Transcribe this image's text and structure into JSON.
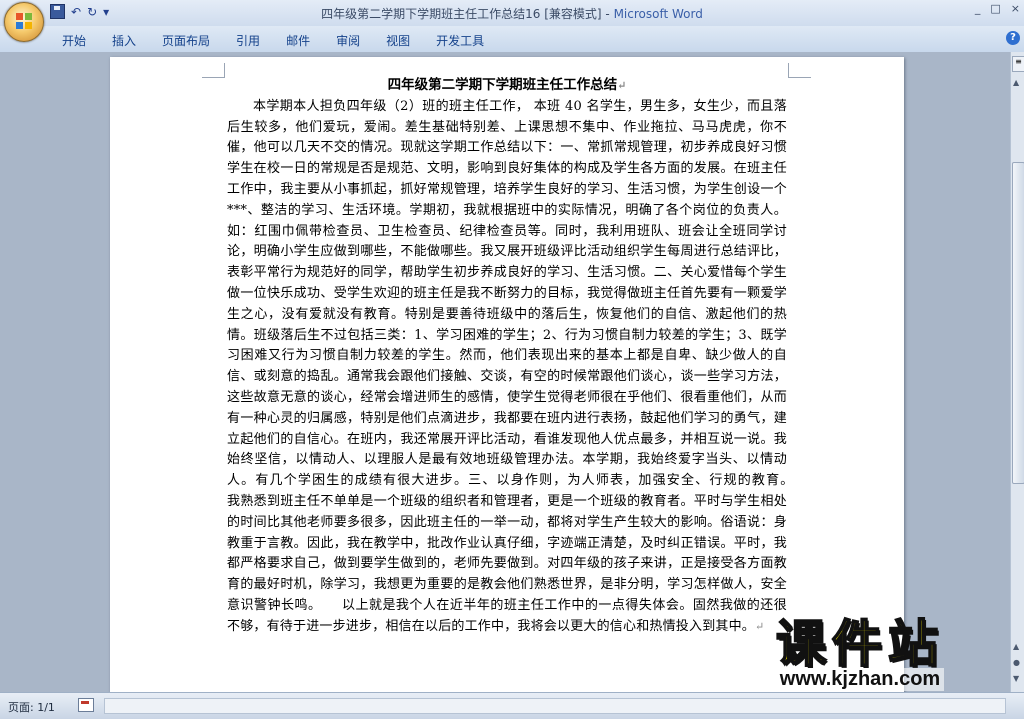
{
  "window": {
    "title": "四年级第二学期下学期班主任工作总结16 [兼容模式] - ",
    "app_name": "Microsoft Word",
    "controls": [
      "_",
      "□",
      "×"
    ]
  },
  "qat": {
    "undo_glyph": "↶",
    "redo_glyph": "↻",
    "dropdown_glyph": "▾"
  },
  "ribbon": {
    "tabs": [
      "开始",
      "插入",
      "页面布局",
      "引用",
      "邮件",
      "审阅",
      "视图",
      "开发工具"
    ],
    "help_label": "?"
  },
  "document": {
    "title": "四年级第二学期下学期班主任工作总结",
    "body": "本学期本人担负四年级（2）班的班主任工作， 本班 40 名学生，男生多，女生少，而且落后生较多，他们爱玩，爱闹。差生基础特别差、上课思想不集中、作业拖拉、马马虎虎，你不催，他可以几天不交的情况。现就这学期工作总结以下：一、常抓常规管理，初步养成良好习惯　　学生在校一日的常规是否是规范、文明，影响到良好集体的构成及学生各方面的发展。在班主任工作中，我主要从小事抓起，抓好常规管理，培养学生良好的学习、生活习惯，为学生创设一个***、整洁的学习、生活环境。学期初，我就根据班中的实际情况，明确了各个岗位的负责人。如：红围巾佩带检查员、卫生检查员、纪律检查员等。同时，我利用班队、班会让全班同学讨论，明确小学生应做到哪些，不能做哪些。我又展开班级评比活动组织学生每周进行总结评比，表彰平常行为规范好的同学，帮助学生初步养成良好的学习、生活习惯。二、关心爱惜每个学生　　做一位快乐成功、受学生欢迎的班主任是我不断努力的目标，我觉得做班主任首先要有一颗爱学生之心，没有爱就没有教育。特别是要善待班级中的落后生，恢复他们的自信、激起他们的热情。班级落后生不过包括三类：1、学习困难的学生；2、行为习惯自制力较差的学生；3、既学习困难又行为习惯自制力较差的学生。然而，他们表现出来的基本上都是自卑、缺少做人的自信、或刻意的捣乱。通常我会跟他们接触、交谈，有空的时候常跟他们谈心，谈一些学习方法，这些故意无意的谈心，经常会增进师生的感情，使学生觉得老师很在乎他们、很看重他们，从而有一种心灵的归属感，特别是他们点滴进步，我都要在班内进行表扬，鼓起他们学习的勇气，建立起他们的自信心。在班内，我还常展开评比活动，看谁发现他人优点最多，并相互说一说。我始终坚信，以情动人、以理服人是最有效地班级管理办法。本学期，我始终爱字当头、以情动人。有几个学困生的成绩有很大进步。三、以身作则，为人师表，加强安全、行规的教育。　　我熟悉到班主任不单单是一个班级的组织者和管理者，更是一个班级的教育者。平时与学生相处的时间比其他老师要多很多，因此班主任的一举一动，都将对学生产生较大的影响。俗语说：身教重于言教。因此，我在教学中，批改作业认真仔细，字迹端正清楚，及时纠正错误。平时，我都严格要求自己，做到要学生做到的，老师先要做到。对四年级的孩子来讲，正是接受各方面教育的最好时机，除学习，我想更为重要的是教会他们熟悉世界，是非分明，学习怎样做人，安全意识警钟长鸣。　　以上就是我个人在近半年的班主任工作中的一点得失体会。固然我做的还很不够，有待于进一步进步，相信在以后的工作中，我将会以更大的信心和热情投入到其中。"
  },
  "watermark": {
    "main": "课件站",
    "url": "www.kjzhan.com"
  },
  "statusbar": {
    "page_info": "页面: 1/1"
  }
}
